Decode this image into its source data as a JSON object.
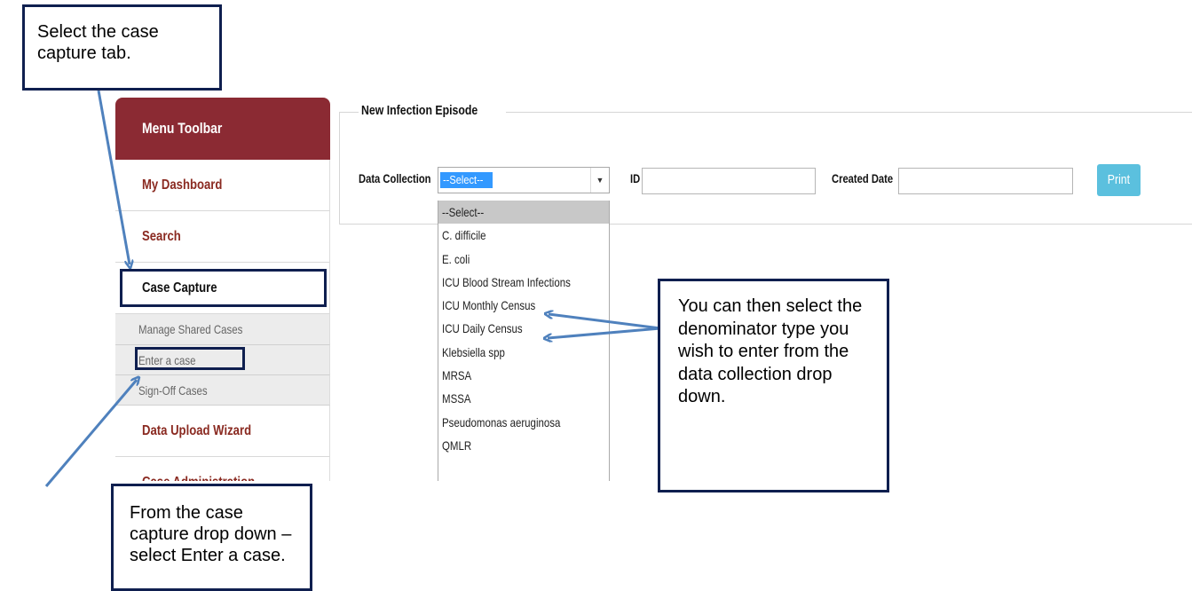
{
  "sidebar": {
    "header": "Menu Toolbar",
    "items": [
      {
        "label": "My Dashboard"
      },
      {
        "label": "Search"
      },
      {
        "label": "Case Capture"
      },
      {
        "label": "Data Upload Wizard"
      },
      {
        "label": "Case Administration"
      }
    ],
    "sub_items": [
      {
        "label": "Manage Shared Cases"
      },
      {
        "label": "Enter a case"
      },
      {
        "label": "Sign-Off Cases"
      }
    ]
  },
  "form": {
    "legend": "New Infection Episode",
    "data_collection_label": "Data Collection",
    "data_collection_value": "--Select--",
    "id_label": "ID",
    "id_value": "",
    "created_date_label": "Created Date",
    "created_date_value": "",
    "print_label": "Print"
  },
  "dropdown": {
    "options": [
      "--Select--",
      "C. difficile",
      "E. coli",
      "ICU Blood Stream Infections",
      "ICU Monthly Census",
      "ICU Daily Census",
      "Klebsiella spp",
      "MRSA",
      "MSSA",
      "Pseudomonas aeruginosa",
      "QMLR"
    ]
  },
  "callouts": {
    "top_left": "Select the case capture tab.",
    "bottom_left": "From the case capture drop down – select Enter a case.",
    "right": "You can then select the denominator type you wish to enter from the data collection drop down."
  },
  "colors": {
    "menu_header": "#8b2a33",
    "menu_text": "#8a2a21",
    "callout_border": "#0f1f4f",
    "arrow": "#4f81bd",
    "print_button": "#5bc0de",
    "selection": "#3399ff"
  }
}
